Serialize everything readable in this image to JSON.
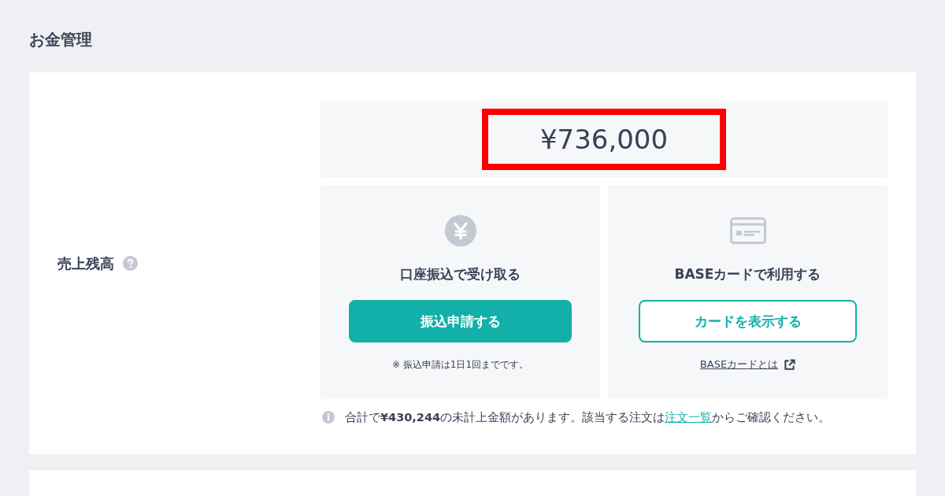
{
  "page": {
    "title": "お金管理"
  },
  "balance": {
    "label": "売上残高",
    "amount": "¥736,000",
    "highlighted": true
  },
  "options": [
    {
      "kind": "transfer",
      "heading": "口座振込で受け取る",
      "button": "振込申請する",
      "note": "※ 振込申請は1日1回までです。"
    },
    {
      "kind": "card",
      "heading": "BASEカードで利用する",
      "button": "カードを表示する",
      "link": "BASEカードとは"
    }
  ],
  "info": {
    "before": "合計で**¥430,244**の未計上金額があります。該当する注文は",
    "link": "注文一覧",
    "after": "からご確認ください。"
  }
}
